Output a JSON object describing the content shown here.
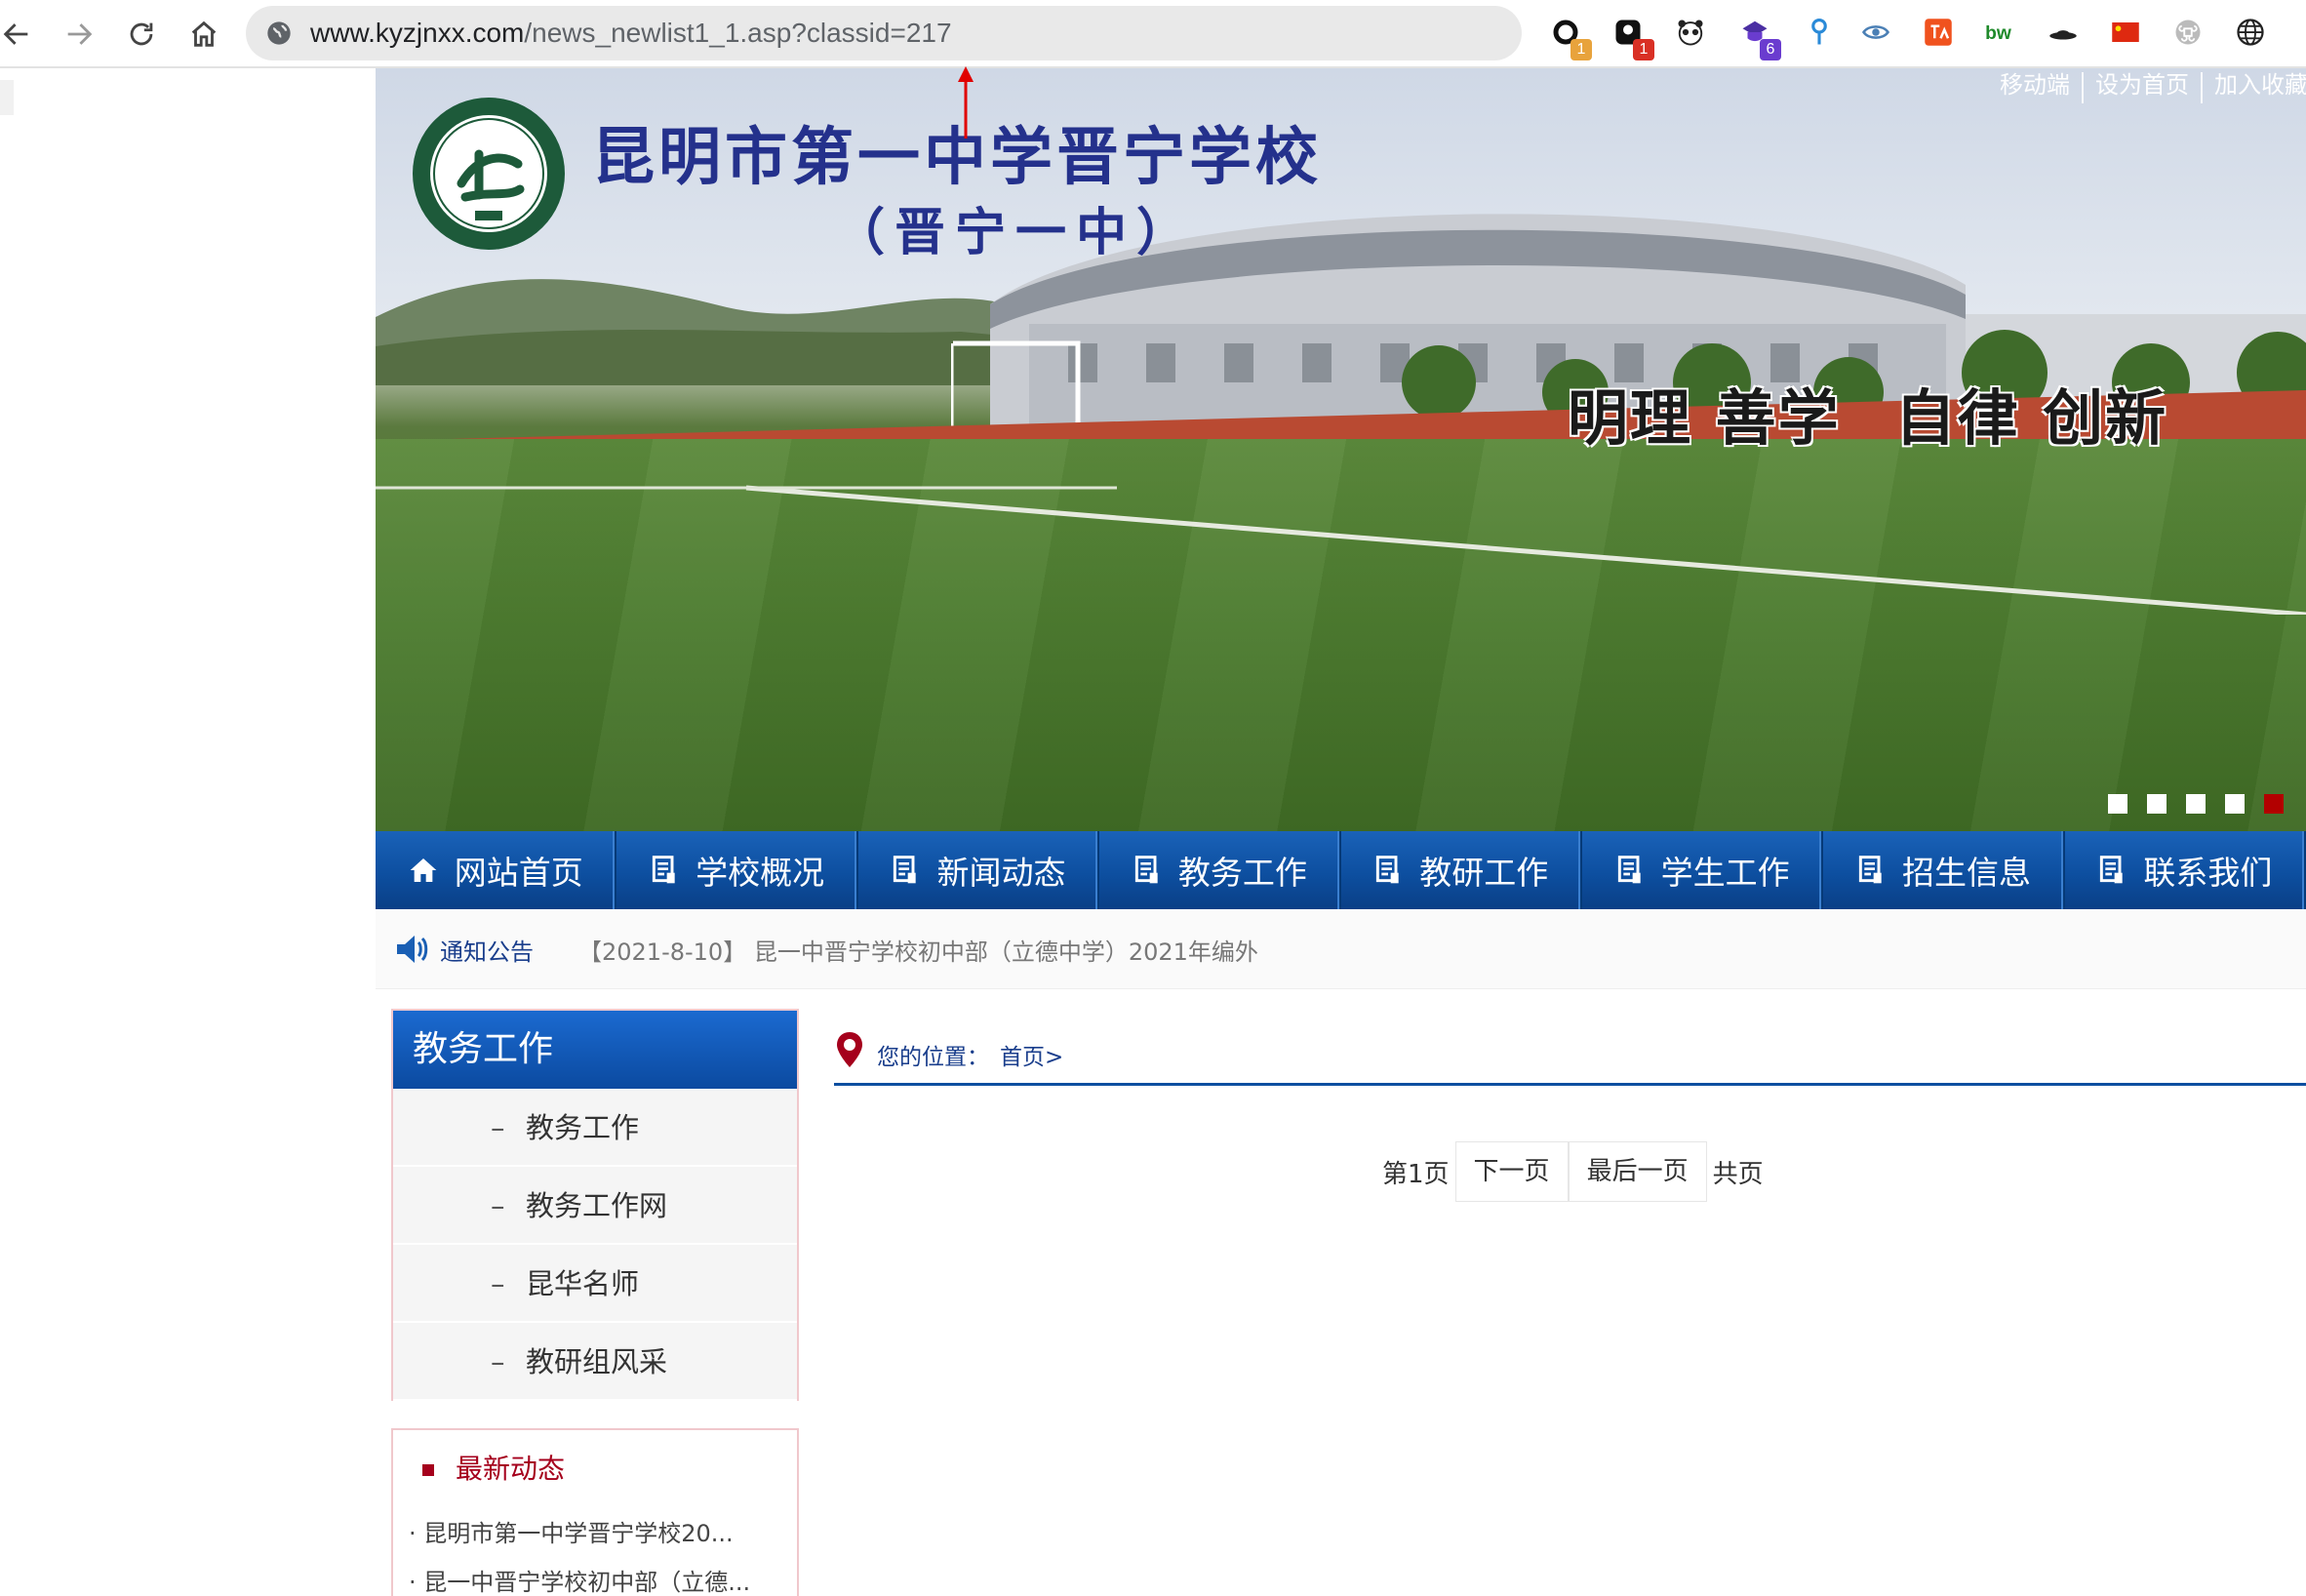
{
  "browser": {
    "url_host": "www.kyzjnxx.com",
    "url_path": "/news_newlist1_1.asp?classid=217",
    "extensions": [
      {
        "icon": "circle-ring-icon",
        "badge": "1",
        "badge_color": "#e8a33c"
      },
      {
        "icon": "dark-square-icon",
        "badge": "1",
        "badge_color": "#d93025"
      },
      {
        "icon": "panda-icon",
        "badge": "",
        "badge_color": ""
      },
      {
        "icon": "graduation-cap-icon",
        "badge": "6",
        "badge_color": "#6a3ccf"
      },
      {
        "icon": "pin-icon",
        "badge": "",
        "badge_color": ""
      },
      {
        "icon": "eye-icon",
        "badge": "",
        "badge_color": ""
      },
      {
        "icon": "translate-icon",
        "badge": "",
        "badge_color": ""
      },
      {
        "icon": "bw-icon",
        "badge": "",
        "badge_color": ""
      },
      {
        "icon": "hat-icon",
        "badge": "",
        "badge_color": ""
      },
      {
        "icon": "china-flag-icon",
        "badge": "",
        "badge_color": ""
      },
      {
        "icon": "command-icon",
        "badge": "",
        "badge_color": ""
      },
      {
        "icon": "globe-grid-icon",
        "badge": "",
        "badge_color": ""
      }
    ]
  },
  "header": {
    "school_name": "昆明市第一中学晋宁学校",
    "school_sub": "（晋宁一中）",
    "motto_a": "明理 善学",
    "motto_b": "自律 创新",
    "top_links": [
      "移动端",
      "设为首页",
      "加入收藏"
    ],
    "slide_count": 5,
    "active_slide": 5
  },
  "nav": {
    "items": [
      {
        "label": "网站首页",
        "icon": "home-icon"
      },
      {
        "label": "学校概况",
        "icon": "doc-icon"
      },
      {
        "label": "新闻动态",
        "icon": "doc-icon"
      },
      {
        "label": "教务工作",
        "icon": "doc-icon"
      },
      {
        "label": "教研工作",
        "icon": "doc-icon"
      },
      {
        "label": "学生工作",
        "icon": "doc-icon"
      },
      {
        "label": "招生信息",
        "icon": "doc-icon"
      },
      {
        "label": "联系我们",
        "icon": "doc-icon"
      }
    ]
  },
  "notice": {
    "label": "通知公告",
    "message": "【2021-8-10】   昆一中晋宁学校初中部（立德中学）2021年编外"
  },
  "sidebar": {
    "title": "教务工作",
    "items": [
      "教务工作",
      "教务工作网",
      "昆华名师",
      "教研组风采"
    ]
  },
  "news": {
    "title": "最新动态",
    "items": [
      "· 昆明市第一中学晋宁学校20...",
      "· 昆一中晋宁学校初中部（立德..."
    ]
  },
  "breadcrumb": {
    "label": "您的位置：",
    "home": "首页>"
  },
  "pager": {
    "current": "第1页",
    "next": "下一页",
    "last": "最后一页",
    "total": "共页"
  },
  "colors": {
    "nav_blue": "#0d4fa0",
    "title_navy": "#24318c",
    "accent_red": "#a5001c"
  }
}
